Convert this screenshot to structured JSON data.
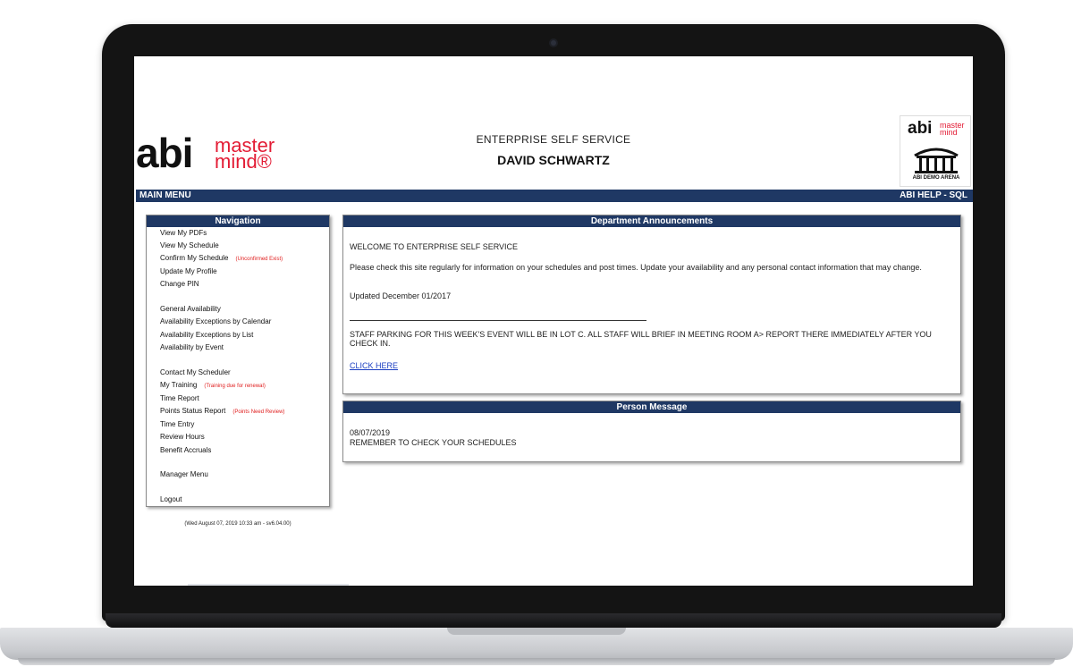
{
  "brand": {
    "logo_main": "abi",
    "logo_sub_line1": "master",
    "logo_sub_line2": "mind®",
    "logo_small_main": "abi",
    "logo_small_sub_line1": "master",
    "logo_small_sub_line2": "mind",
    "arena_label": "ABI DEMO ARENA",
    "accent_color": "#e31b34",
    "navy_color": "#1f3864"
  },
  "header": {
    "title": "ENTERPRISE SELF SERVICE",
    "user_name": "DAVID SCHWARTZ"
  },
  "menubar": {
    "left_label": "MAIN MENU",
    "right_label": "ABI HELP - SQL"
  },
  "navigation": {
    "title": "Navigation",
    "items": [
      {
        "label": "View My PDFs",
        "note": ""
      },
      {
        "label": "View My Schedule",
        "note": ""
      },
      {
        "label": "Confirm My Schedule",
        "note": "(Unconfirmed Exist)"
      },
      {
        "label": "Update My Profile",
        "note": ""
      },
      {
        "label": "Change PIN",
        "note": ""
      },
      {
        "label": "General Availability",
        "note": ""
      },
      {
        "label": "Availability Exceptions by Calendar",
        "note": ""
      },
      {
        "label": "Availability Exceptions by List",
        "note": ""
      },
      {
        "label": "Availability by Event",
        "note": ""
      },
      {
        "label": "Contact My Scheduler",
        "note": ""
      },
      {
        "label": "My Training",
        "note": "(Training due for renewal)"
      },
      {
        "label": "Time Report",
        "note": ""
      },
      {
        "label": "Points Status Report",
        "note": "(Points Need Review)"
      },
      {
        "label": "Time Entry",
        "note": ""
      },
      {
        "label": "Review Hours",
        "note": ""
      },
      {
        "label": "Benefit Accruals",
        "note": ""
      },
      {
        "label": "Manager Menu",
        "note": ""
      },
      {
        "label": "Logout",
        "note": ""
      }
    ],
    "timestamp": "(Wed August 07, 2019 10:33 am - sv6.04.00)"
  },
  "announcements": {
    "title": "Department Announcements",
    "welcome": "WELCOME TO ENTERPRISE SELF SERVICE",
    "intro": "Please check this site regularly for information on your schedules and post times. Update your availability and any personal contact information that may change.",
    "updated": "Updated December 01/2017",
    "parking": "STAFF PARKING FOR THIS WEEK'S EVENT WILL BE IN LOT C. ALL STAFF WILL BRIEF IN MEETING ROOM A> REPORT THERE IMMEDIATELY AFTER YOU CHECK IN.",
    "link_label": "CLICK HERE"
  },
  "person_message": {
    "title": "Person Message",
    "date": "08/07/2019",
    "text": "REMEMBER TO CHECK YOUR SCHEDULES"
  }
}
